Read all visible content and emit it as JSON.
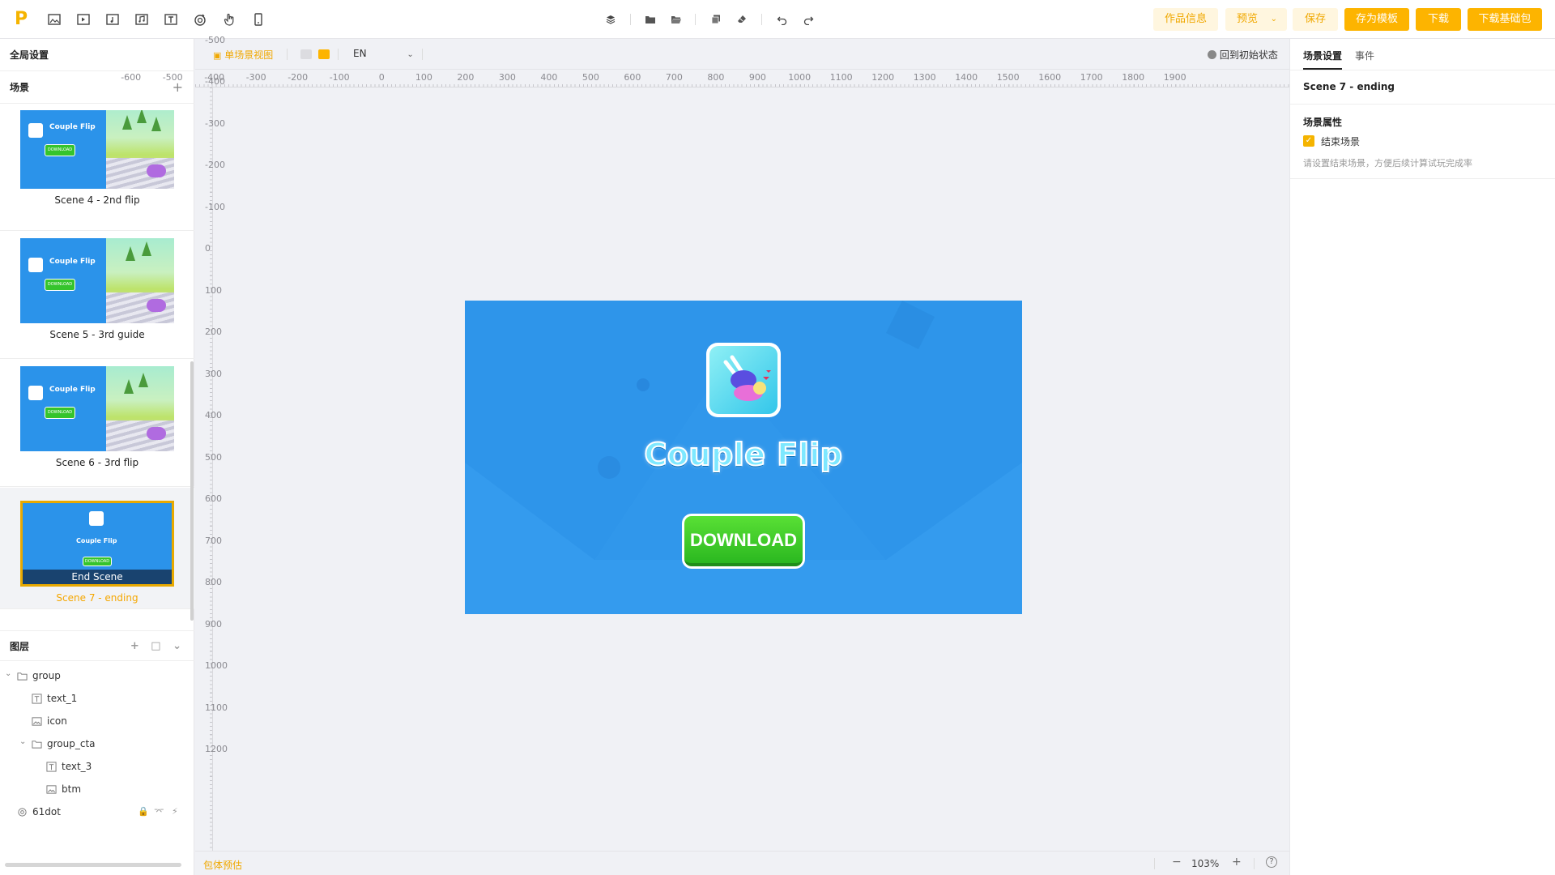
{
  "toolbar": {
    "logo": "P",
    "left_tools": [
      "image-icon",
      "video-icon",
      "audio-file-icon",
      "music-icon",
      "text-icon",
      "spiral-icon",
      "hand-pointer-icon",
      "phone-icon"
    ],
    "center_tools": [
      "layers-icon",
      "folder-icon",
      "folder-open-icon",
      "copy-icon",
      "eraser-icon",
      "undo-icon",
      "redo-icon"
    ],
    "buttons": {
      "info": "作品信息",
      "preview": "预览",
      "save": "保存",
      "save_template": "存为模板",
      "download": "下载",
      "download_base": "下载基础包"
    }
  },
  "left": {
    "global_settings": "全局设置",
    "scenes_title": "场景",
    "scenes": [
      {
        "label": "Scene 4 - 2nd flip",
        "thumb_title": "Couple Flip",
        "thumb_cta": "DOWNLOAD"
      },
      {
        "label": "Scene 5 - 3rd guide",
        "thumb_title": "Couple Flip",
        "thumb_cta": "DOWNLOAD"
      },
      {
        "label": "Scene 6 - 3rd flip",
        "thumb_title": "Couple Flip",
        "thumb_cta": "DOWNLOAD"
      },
      {
        "label": "Scene 7 - ending",
        "thumb_title": "Couple Flip",
        "thumb_cta": "DOWNLOAD",
        "overlay": "End Scene"
      }
    ],
    "layers_title": "图层",
    "layers": [
      {
        "name": "group",
        "type": "folder"
      },
      {
        "name": "text_1",
        "type": "text"
      },
      {
        "name": "icon",
        "type": "image"
      },
      {
        "name": "group_cta",
        "type": "folder"
      },
      {
        "name": "text_3",
        "type": "text"
      },
      {
        "name": "btm",
        "type": "image"
      },
      {
        "name": "61dot",
        "type": "particle"
      }
    ]
  },
  "canvas": {
    "view_mode": "单场景视图",
    "language": "EN",
    "reset": "回到初始状态",
    "ruler_x": [
      "-600",
      "-500",
      "-400",
      "-300",
      "-200",
      "-100",
      "0",
      "100",
      "200",
      "300",
      "400",
      "500",
      "600",
      "700",
      "800",
      "900",
      "1000",
      "1100",
      "1200",
      "1300",
      "1400",
      "1500",
      "1600",
      "1700",
      "1800",
      "1900"
    ],
    "ruler_y": [
      "-500",
      "-400",
      "-300",
      "-200",
      "-100",
      "0",
      "100",
      "200",
      "300",
      "400",
      "500",
      "600",
      "700",
      "800",
      "900",
      "1000",
      "1100",
      "1200"
    ],
    "stage": {
      "title": "Couple Flip",
      "cta": "DOWNLOAD",
      "bg_color": "#2e95ea"
    },
    "footer_left": "包体预估",
    "zoom": "103%"
  },
  "right": {
    "tabs": [
      "场景设置",
      "事件"
    ],
    "scene_name": "Scene 7 - ending",
    "props_title": "场景属性",
    "end_scene_checkbox": "结束场景",
    "hint": "请设置结束场景，方便后续计算试玩完成率"
  },
  "colors": {
    "accent": "#fdb400",
    "accent_light": "#fff6df",
    "stage_blue": "#2e95ea"
  }
}
